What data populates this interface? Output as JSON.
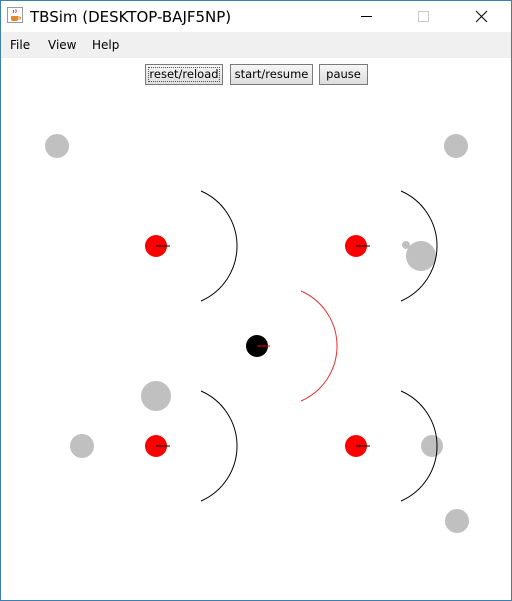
{
  "window": {
    "title": "TBSim (DESKTOP-BAJF5NP)"
  },
  "menu": {
    "file": "File",
    "view": "View",
    "help": "Help"
  },
  "toolbar": {
    "reset_label": "reset/reload",
    "start_label": "start/resume",
    "pause_label": "pause"
  },
  "colors": {
    "robot_red": "#ff0000",
    "robot_black": "#000000",
    "obstacle_gray": "#c0c0c0",
    "arc_black": "#000000",
    "arc_red": "#e53030"
  },
  "icons": {
    "app": "java-cup-icon",
    "minimize": "minimize-icon",
    "maximize": "maximize-icon",
    "close": "close-icon"
  }
}
